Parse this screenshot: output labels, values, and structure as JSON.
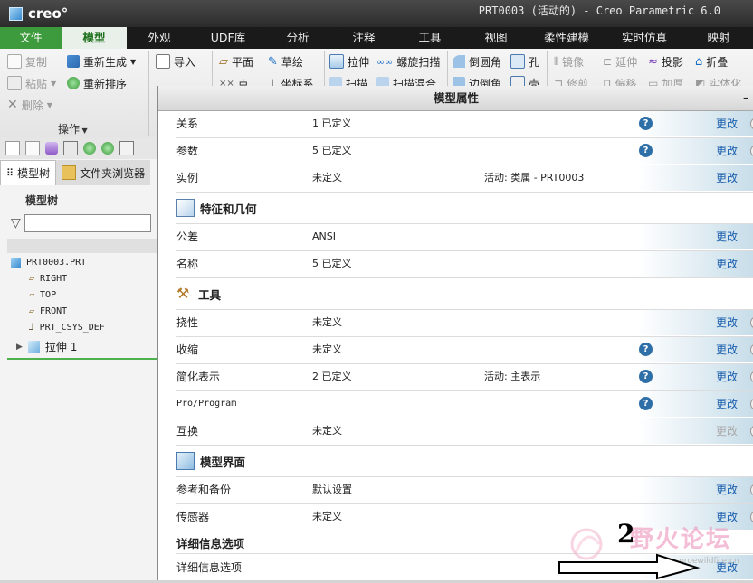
{
  "app": {
    "logo": "creo°",
    "window_title": "PRT0003 (活动的) - Creo Parametric 6.0"
  },
  "tabs": [
    {
      "label": "文件"
    },
    {
      "label": "模型"
    },
    {
      "label": "外观"
    },
    {
      "label": "UDF库"
    },
    {
      "label": "分析"
    },
    {
      "label": "注释"
    },
    {
      "label": "工具"
    },
    {
      "label": "视图"
    },
    {
      "label": "柔性建模"
    },
    {
      "label": "实时仿真"
    },
    {
      "label": "映射"
    }
  ],
  "ribbon": {
    "ops": {
      "copy": "复制",
      "paste": "粘贴",
      "delete": "删除",
      "regen": "重新生成",
      "reorder": "重新排序",
      "group": "操作"
    },
    "get_data": {
      "import": "导入"
    },
    "datum": {
      "plane": "平面",
      "sketch": "草绘",
      "point": "点",
      "csys": "坐标系"
    },
    "shapes": {
      "extrude": "拉伸",
      "helical": "螺旋扫描",
      "sweep": "扫描",
      "sweep_blend": "扫描混合"
    },
    "engineering": {
      "round": "倒圆角",
      "hole": "孔",
      "chamfer": "边倒角",
      "shell": "壳"
    },
    "editing": {
      "mirror": "镜像",
      "extend": "延伸",
      "project": "投影",
      "wrap": "折叠",
      "trim": "修剪",
      "offset": "偏移",
      "thicken": "加厚",
      "solidify": "实体化"
    }
  },
  "left_panel": {
    "tabs": [
      {
        "label": "模型树"
      },
      {
        "label": "文件夹浏览器"
      }
    ],
    "tree_title": "模型树",
    "nodes": [
      {
        "label": "PRT0003.PRT"
      },
      {
        "label": "RIGHT"
      },
      {
        "label": "TOP"
      },
      {
        "label": "FRONT"
      },
      {
        "label": "PRT_CSYS_DEF"
      },
      {
        "label": "拉伸 1"
      }
    ]
  },
  "dialog": {
    "title": "模型属性",
    "minimize": "–",
    "edit_label": "更改",
    "help_glyph": "?",
    "rows_top": [
      {
        "label": "关系",
        "value": "1 已定义",
        "active": ""
      },
      {
        "label": "参数",
        "value": "5 已定义",
        "active": ""
      },
      {
        "label": "实例",
        "value": "未定义",
        "active": "活动: 类属 - PRT0003"
      }
    ],
    "sec_features": {
      "title": "特征和几何"
    },
    "rows_features": [
      {
        "label": "公差",
        "value": "ANSI"
      },
      {
        "label": "名称",
        "value": "5 已定义"
      }
    ],
    "sec_tools": {
      "title": "工具"
    },
    "rows_tools": [
      {
        "label": "挠性",
        "value": "未定义",
        "active": ""
      },
      {
        "label": "收缩",
        "value": "未定义",
        "active": ""
      },
      {
        "label": "简化表示",
        "value": "2 已定义",
        "active": "活动: 主表示"
      },
      {
        "label": "Pro/Program",
        "value": "",
        "active": ""
      },
      {
        "label": "互换",
        "value": "未定义",
        "active": ""
      }
    ],
    "sec_interface": {
      "title": "模型界面"
    },
    "rows_interface": [
      {
        "label": "参考和备份",
        "value": "默认设置"
      },
      {
        "label": "传感器",
        "value": "未定义"
      }
    ],
    "sec_detail": {
      "title": "详细信息选项"
    },
    "rows_detail": [
      {
        "label": "详细信息选项"
      }
    ]
  },
  "overlay": {
    "annotation_number": "2",
    "watermark_text": "野火论坛",
    "watermark_url": "www.proewildfire.cn"
  },
  "colors": {
    "accent_green": "#3d9b3d",
    "link_blue": "#1a5fae",
    "help_blue": "#2f6fa8"
  }
}
